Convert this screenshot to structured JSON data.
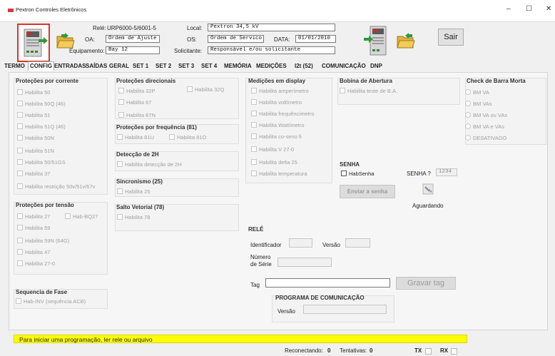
{
  "window": {
    "title": "Pextron Controles Eletrônicos",
    "minimize": "–",
    "maximize": "☐",
    "close": "✕"
  },
  "header": {
    "rele_label": "Relé:",
    "rele_value": "URP6000-5/6001-5",
    "oa_label": "OA:",
    "oa_value": "Ordem de Ajuste",
    "equip_label": "Equipamento:",
    "equip_value": "Bay 12",
    "local_label": "Local:",
    "local_value": "Pextron 34,5 kV",
    "os_label": "OS:",
    "os_value": "Ordem de Servico",
    "data_label": "DATA:",
    "data_value": "01/01/2010",
    "solic_label": "Solicitante:",
    "solic_value": "Responsável e/ou solicitante",
    "sair_label": "Sair"
  },
  "tabs": [
    "TERMO",
    "CONFIG",
    "ENTRADAS",
    "SAÍDAS",
    "GERAL",
    "SET 1",
    "SET 2",
    "SET 3",
    "SET 4",
    "MEMÓRIA",
    "MEDIÇÕES",
    "I2t (52)",
    "COMUNICAÇÃO",
    "DNP"
  ],
  "prot_corrente": {
    "title": "Proteções por corrente",
    "items": [
      "Habilita 50",
      "Habilita 50Q (46)",
      "Habilita 51",
      "Habilita 51Q (46)",
      "Habilita 50N",
      "Habilita 51N",
      "Habilita 50/51GS",
      "Habilita 37",
      "Habilita restrição 50v/51v/67v"
    ]
  },
  "prot_tensao": {
    "title": "Proteções por tensão",
    "items": [
      "Habilita 27",
      "Hab-BQ27",
      "Habilita 59",
      "Habilita 59N (64G)",
      "Habilita 47",
      "Habilita 27-0"
    ]
  },
  "seq_fase": {
    "title": "Sequencia de Fase",
    "items": [
      "Hab-INV (sequência ACB)"
    ]
  },
  "prot_direcionais": {
    "title": "Proteções direcionais",
    "items": [
      "Habilita 32P",
      "Habilita 32Q",
      "Habilita 67",
      "Habilita 67N"
    ]
  },
  "prot_freq": {
    "title": "Proteções por frequência (81)",
    "items": [
      "Habilita 81U",
      "Habilita 81O"
    ]
  },
  "det_2h": {
    "title": "Detecção de 2H",
    "items": [
      "Habilita detecção de 2H"
    ]
  },
  "sincronismo": {
    "title": "Sincronismo (25)",
    "items": [
      "Habilita 25"
    ]
  },
  "salto": {
    "title": "Salto Vetorial (78)",
    "items": [
      "Habilita 78"
    ]
  },
  "medicoes": {
    "title": "Medições em display",
    "items": [
      "Habilita amperímetro",
      "Habilita voltímetro",
      "Habilita frequêncímetro",
      "Habilita Wattímetro",
      "Habilita co-seno fi",
      "Habilita V 27-0",
      "Habilita delta 25",
      "Habilita temperatura"
    ]
  },
  "bobina": {
    "title": "Bobina de Abertura",
    "items": [
      "Habilita teste de B.A."
    ]
  },
  "senha": {
    "title": "SENHA",
    "hab_label": "HabSenha",
    "q_label": "SENHA ?",
    "value": "1234",
    "send_label": "Enviar a senha",
    "status": "Aguardando"
  },
  "check_barra": {
    "title": "Check de Barra Morta",
    "options": [
      "BM VA",
      "BM VAs",
      "BM VA ou VAs",
      "BM VA e VAs",
      "DESATIVADO"
    ]
  },
  "rele": {
    "title": "RELÉ",
    "id_label": "Identificador",
    "versao_label": "Versão",
    "serie_label": "Número de Série",
    "tag_label": "Tag",
    "gravar_label": "Gravar tag"
  },
  "programa": {
    "title": "PROGRAMA DE COMUNICAÇÃO",
    "versao_label": "Versão"
  },
  "status": {
    "message": "Para iniciar uma programação, ler rele ou arquivo"
  },
  "footer": {
    "reconectando_label": "Reconectando:",
    "reconectando_value": "0",
    "tentativas_label": "Tentativas:",
    "tentativas_value": "0",
    "tx_label": "TX",
    "rx_label": "RX"
  }
}
